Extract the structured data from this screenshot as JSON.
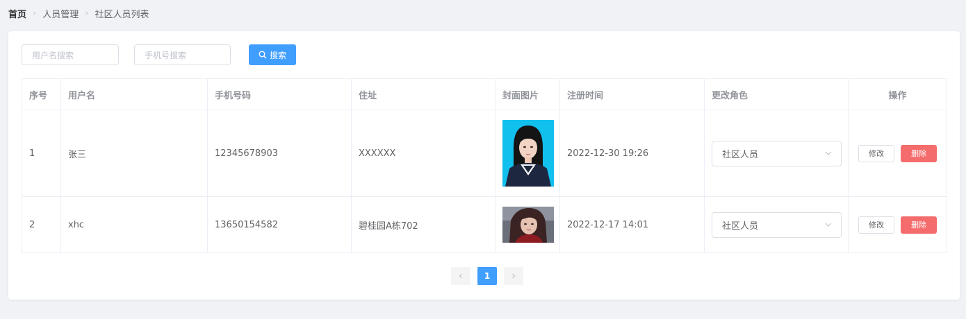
{
  "breadcrumb": {
    "items": [
      "首页",
      "人员管理",
      "社区人员列表"
    ]
  },
  "search": {
    "username_placeholder": "用户名搜索",
    "phone_placeholder": "手机号搜索",
    "button_label": "搜索"
  },
  "table": {
    "headers": [
      "序号",
      "用户名",
      "手机号码",
      "住址",
      "封面图片",
      "注册时间",
      "更改角色",
      "操作"
    ],
    "rows": [
      {
        "index": "1",
        "username": "张三",
        "phone": "12345678903",
        "address": "XXXXXX",
        "registered": "2022-12-30 19:26",
        "role": "社区人员",
        "edit_label": "修改",
        "delete_label": "删除"
      },
      {
        "index": "2",
        "username": "xhc",
        "phone": "13650154582",
        "address": "碧桂园A栋702",
        "registered": "2022-12-17 14:01",
        "role": "社区人员",
        "edit_label": "修改",
        "delete_label": "删除"
      }
    ]
  },
  "pagination": {
    "current_page": "1",
    "prev_icon": "chevron-left-icon",
    "next_icon": "chevron-right-icon"
  },
  "colors": {
    "primary": "#409eff",
    "danger": "#f56c6c",
    "background": "#f0f2f5"
  }
}
